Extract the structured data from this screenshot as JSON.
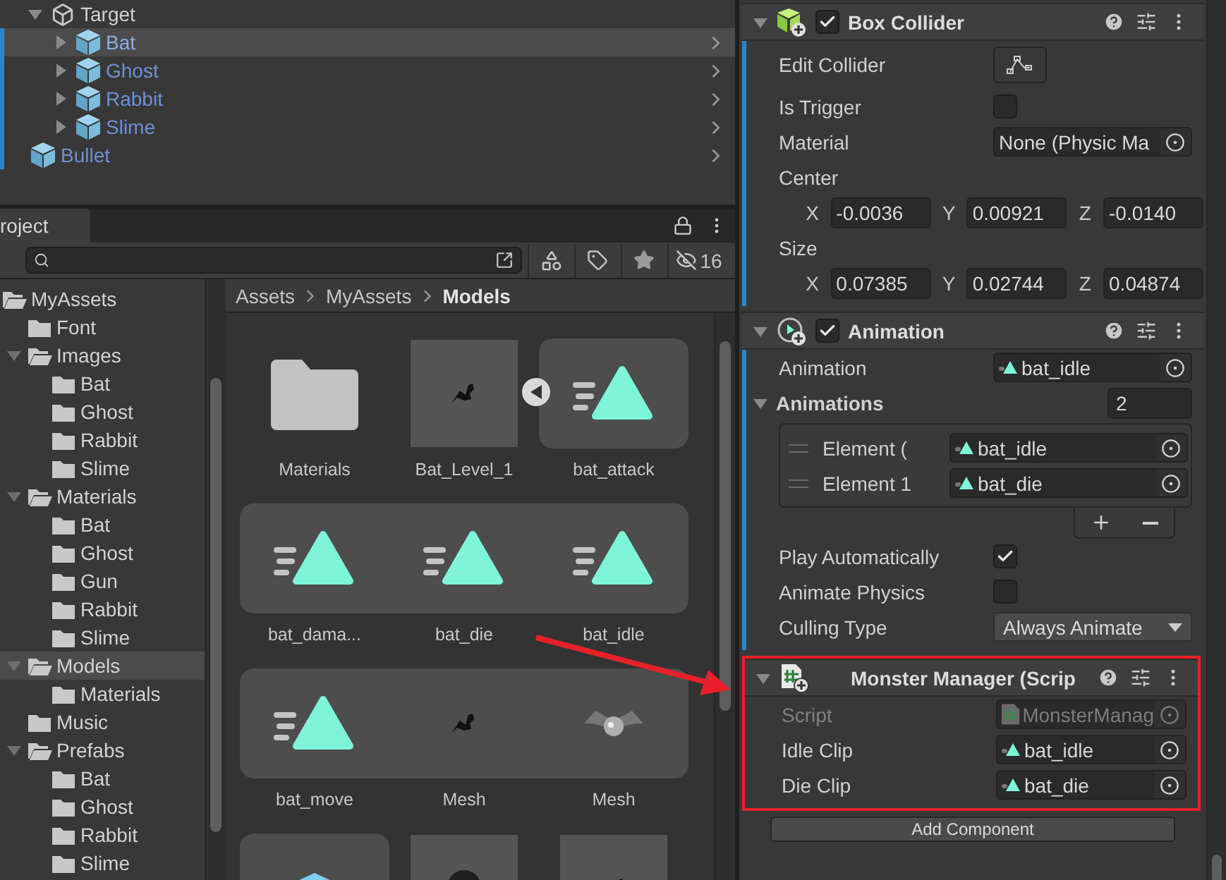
{
  "hierarchy": {
    "items": [
      {
        "name": "Target",
        "kind": "object",
        "expanded": true,
        "selected": false,
        "children": [
          {
            "name": "Bat",
            "kind": "prefab",
            "expanded": false,
            "selected": true
          },
          {
            "name": "Ghost",
            "kind": "prefab",
            "expanded": false,
            "selected": false
          },
          {
            "name": "Rabbit",
            "kind": "prefab",
            "expanded": false,
            "selected": false
          },
          {
            "name": "Slime",
            "kind": "prefab",
            "expanded": false,
            "selected": false
          }
        ]
      },
      {
        "name": "Bullet",
        "kind": "prefab",
        "selected": false
      }
    ]
  },
  "project": {
    "tab": {
      "label": "roject",
      "selected": true
    },
    "filter_count": "16",
    "tree": [
      {
        "name": "MyAssets",
        "expanded": true,
        "selected": false,
        "children": [
          {
            "name": "Font",
            "selected": false
          },
          {
            "name": "Images",
            "expanded": true,
            "selected": false,
            "children": [
              {
                "name": "Bat",
                "selected": false
              },
              {
                "name": "Ghost",
                "selected": false
              },
              {
                "name": "Rabbit",
                "selected": false
              },
              {
                "name": "Slime",
                "selected": false
              }
            ]
          },
          {
            "name": "Materials",
            "expanded": true,
            "selected": false,
            "children": [
              {
                "name": "Bat",
                "selected": false
              },
              {
                "name": "Ghost",
                "selected": false
              },
              {
                "name": "Gun",
                "selected": false
              },
              {
                "name": "Rabbit",
                "selected": false
              },
              {
                "name": "Slime",
                "selected": false
              }
            ]
          },
          {
            "name": "Models",
            "expanded": true,
            "selected": true,
            "children": [
              {
                "name": "Materials",
                "selected": false
              }
            ]
          },
          {
            "name": "Music",
            "selected": false
          },
          {
            "name": "Prefabs",
            "expanded": true,
            "selected": false,
            "children": [
              {
                "name": "Bat",
                "selected": false
              },
              {
                "name": "Ghost",
                "selected": false
              },
              {
                "name": "Rabbit",
                "selected": false
              },
              {
                "name": "Slime",
                "selected": false
              }
            ]
          }
        ]
      }
    ],
    "breadcrumb": [
      "Assets",
      "MyAssets",
      "Models"
    ],
    "assets": [
      {
        "name": "Materials",
        "kind": "folder",
        "sub_asset": false
      },
      {
        "name": "Bat_Level_1",
        "kind": "model",
        "sub_asset": false,
        "expanded": true
      },
      {
        "name": "bat_attack",
        "kind": "animation",
        "sub_asset": true
      },
      {
        "name": "bat_dama...",
        "kind": "animation",
        "sub_asset": true
      },
      {
        "name": "bat_die",
        "kind": "animation",
        "sub_asset": true
      },
      {
        "name": "bat_idle",
        "kind": "animation",
        "sub_asset": true
      },
      {
        "name": "bat_move",
        "kind": "animation",
        "sub_asset": true
      },
      {
        "name": "Mesh",
        "kind": "mesh",
        "sub_asset": true
      },
      {
        "name": "Mesh",
        "kind": "textured_mesh",
        "sub_asset": true
      },
      {
        "kind": "prefab",
        "sub_asset": true
      },
      {
        "kind": "capsule",
        "sub_asset": false
      },
      {
        "kind": "model",
        "sub_asset": false
      }
    ]
  },
  "inspector": {
    "components": [
      {
        "title": "Box Collider",
        "kind": "box_collider",
        "enabled": true,
        "expanded": true,
        "modified": true,
        "highlighted": false,
        "fields": [
          {
            "kind": "button",
            "label": "Edit Collider"
          },
          {
            "kind": "checkbox",
            "label": "Is Trigger",
            "checked": false
          },
          {
            "kind": "object",
            "label": "Material",
            "value": "None (Physic Ma",
            "disabled": false
          },
          {
            "kind": "vector",
            "label": "Center",
            "values": [
              {
                "axis": "X",
                "value": "-0.0036"
              },
              {
                "axis": "Y",
                "value": "0.00921"
              },
              {
                "axis": "Z",
                "value": "-0.0140"
              }
            ]
          },
          {
            "kind": "vector",
            "label": "Size",
            "values": [
              {
                "axis": "X",
                "value": "0.07385"
              },
              {
                "axis": "Y",
                "value": "0.02744"
              },
              {
                "axis": "Z",
                "value": "0.04874"
              }
            ]
          }
        ]
      },
      {
        "title": "Animation",
        "kind": "animation",
        "enabled": true,
        "expanded": true,
        "modified": true,
        "highlighted": false,
        "fields": [
          {
            "kind": "animation_ref",
            "label": "Animation",
            "value": "bat_idle",
            "disabled": false
          },
          {
            "kind": "array",
            "label": "Animations",
            "expanded": true,
            "size": "2",
            "elements": [
              {
                "label": "Element (",
                "value": "bat_idle",
                "kind": "animation_ref"
              },
              {
                "label": "Element 1",
                "value": "bat_die",
                "kind": "animation_ref"
              }
            ]
          },
          {
            "kind": "checkbox",
            "label": "Play Automatically",
            "checked": true
          },
          {
            "kind": "checkbox",
            "label": "Animate Physics",
            "checked": false
          },
          {
            "kind": "dropdown",
            "label": "Culling Type",
            "value": "Always Animate"
          }
        ]
      },
      {
        "title": "Monster Manager (Scrip",
        "kind": "script",
        "expanded": true,
        "modified": false,
        "highlighted": true,
        "fields": [
          {
            "kind": "script_ref",
            "label": "Script",
            "value": "MonsterManag",
            "disabled": true
          },
          {
            "kind": "animation_ref",
            "label": "Idle Clip",
            "value": "bat_idle",
            "disabled": false
          },
          {
            "kind": "animation_ref",
            "label": "Die Clip",
            "value": "bat_die",
            "disabled": false
          }
        ]
      }
    ],
    "add_button": "Add Component"
  },
  "annotation": {
    "arrow": true
  }
}
